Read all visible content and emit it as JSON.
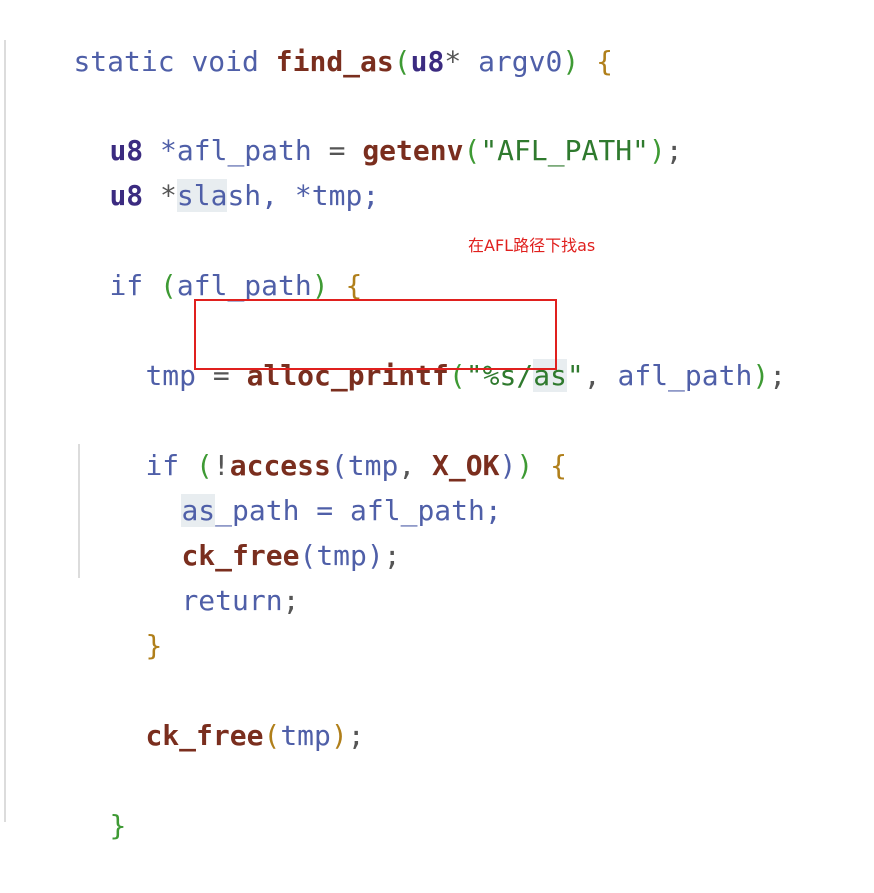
{
  "code": {
    "l1": {
      "kw1": "static",
      "kw2": "void",
      "fn": "find_as",
      "po": "(",
      "type": "u8",
      "star": "*",
      "param": "argv0",
      "pc": ")",
      "brace": "{"
    },
    "l2": {
      "type": "u8",
      "decl": "*afl_path",
      "eq": "=",
      "fn": "getenv",
      "po": "(",
      "str": "\"AFL_PATH\"",
      "pc": ")",
      "semi": ";"
    },
    "l3": {
      "type": "u8",
      "star": "*",
      "hl": "sla",
      "rest": "sh, *tmp;"
    },
    "l4": {
      "kw": "if",
      "po": "(",
      "var": "afl_path",
      "pc": ")",
      "brace": "{"
    },
    "l5": {
      "var": "tmp",
      "eq": "=",
      "fn": "alloc_printf",
      "po": "(",
      "str1": "\"%s/",
      "hl": "as",
      "str2": "\"",
      "comma": ",",
      "arg": "afl_path",
      "pc": ")",
      "semi": ";"
    },
    "l6": {
      "kw": "if",
      "po": "(",
      "bang": "!",
      "fn": "access",
      "po2": "(",
      "arg": "tmp",
      "comma": ",",
      "const": "X_OK",
      "pc2": ")",
      "pc": ")",
      "brace": "{"
    },
    "l7": {
      "hl": "as",
      "rest": "_path = afl_path;"
    },
    "l8": {
      "fn": "ck_free",
      "po": "(",
      "arg": "tmp",
      "pc": ")",
      "semi": ";"
    },
    "l9": {
      "kw": "return",
      "semi": ";"
    },
    "l10": {
      "brace": "}"
    },
    "l11": {
      "fn": "ck_free",
      "po": "(",
      "arg": "tmp",
      "pc": ")",
      "semi": ";"
    },
    "l12": {
      "brace": "}"
    }
  },
  "annotation": {
    "note": "在AFL路径下找as",
    "color": "#e0201e"
  }
}
